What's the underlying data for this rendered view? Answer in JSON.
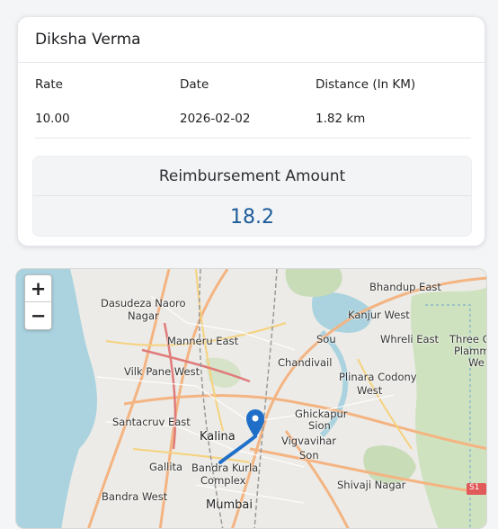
{
  "card": {
    "employee_name": "Diksha Verma",
    "headers": {
      "rate": "Rate",
      "date": "Date",
      "distance": "Distance (In KM)"
    },
    "row": {
      "rate": "10.00",
      "date": "2026-02-02",
      "distance": "1.82 km"
    },
    "reimbursement_label": "Reimbursement Amount",
    "reimbursement_value": "18.2"
  },
  "map": {
    "zoom_in": "+",
    "zoom_out": "−",
    "labels": {
      "bhandup_east": "Bhandup East",
      "dasudeza_naoro": "Dasudeza Naoro",
      "nagar": "Nagar",
      "kanjur_west": "Kanjur West",
      "manneru_east": "Manneru East",
      "sou": "Sou",
      "whreli_east": "Whreli East",
      "three_c": "Three C",
      "plamm": "Plamm",
      "we": "We",
      "chandivail": "Chandivail",
      "vilk_pane_west": "Vilk Pane West",
      "plinara_codony": "Plinara Codony",
      "west": "West",
      "santacruv_east": "Santacruv East",
      "ghickapur": "Ghickapur",
      "sion": "Sion",
      "kalina": "Kalina",
      "vigvavihar": "Vigvavihar",
      "son": "Son",
      "gallita": "Gallita",
      "bandra_kurla": "Bandra Kurla",
      "complex": "Complex",
      "shivaji_nagar": "Shivaji Nagar",
      "bandra_west": "Bandra West",
      "mumbai": "Mumbai",
      "s1": "S1"
    },
    "colors": {
      "route": "#1f6fc9",
      "marker": "#1f6fc9",
      "water": "#aad3df",
      "park": "#c8dcb8"
    }
  }
}
